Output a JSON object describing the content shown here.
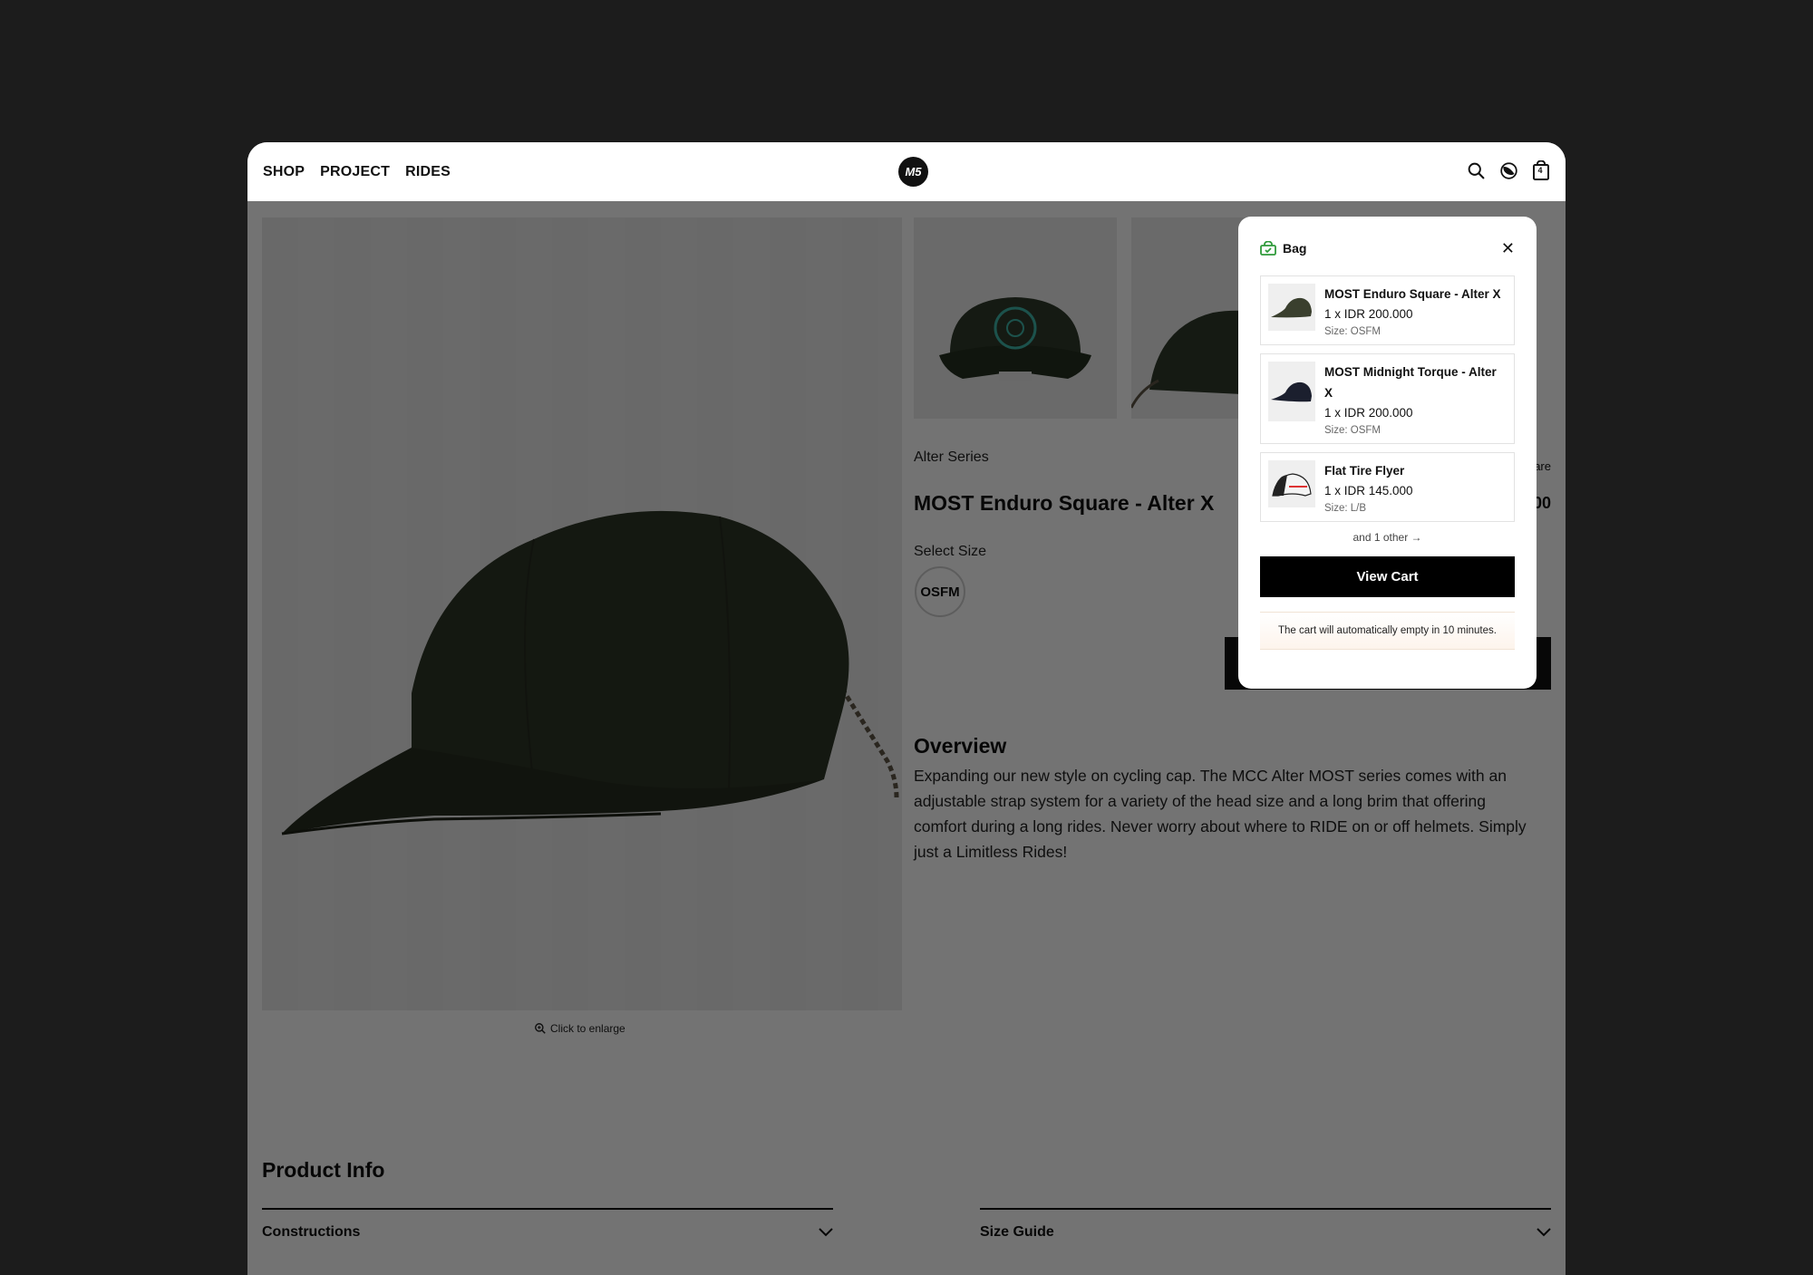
{
  "nav": {
    "items": [
      {
        "label": "SHOP"
      },
      {
        "label": "PROJECT"
      },
      {
        "label": "RIDES"
      }
    ],
    "logo_text": "M5",
    "icons": [
      "search-icon",
      "theme-toggle-icon",
      "cart-icon"
    ],
    "cart_count": "4"
  },
  "product": {
    "series": "Alter Series",
    "title": "MOST Enduro Square - Alter X",
    "price_fragment": "00",
    "share_fragment": "are",
    "select_size_label": "Select Size",
    "size_option": "OSFM",
    "enlarge_label": "Click to enlarge",
    "overview_heading": "Overview",
    "overview_text": "Expanding our new style on cycling cap. The MCC Alter MOST series comes with an adjustable strap system for a variety of the head size and a long brim that offering comfort during a long rides. Never worry about where to RIDE on or off helmets. Simply just a Limitless Rides!",
    "info_heading": "Product Info",
    "accordions": [
      {
        "label": "Constructions"
      },
      {
        "label": "Size Guide"
      }
    ]
  },
  "bag": {
    "title": "Bag",
    "items": [
      {
        "name": "MOST Enduro Square - Alter X",
        "qty_price": "1 x IDR 200.000",
        "size": "Size: OSFM",
        "color": "#3a3f2e"
      },
      {
        "name": "MOST Midnight Torque - Alter X",
        "qty_price": "1 x IDR 200.000",
        "size": "Size: OSFM",
        "color": "#1b1f2e"
      },
      {
        "name": "Flat Tire Flyer",
        "qty_price": "1 x IDR 145.000",
        "size": "Size: L/B",
        "color": "#f4f4f4"
      }
    ],
    "others_label": "and 1 other →",
    "view_cart_label": "View Cart",
    "note": "The cart will automatically empty in 10 minutes."
  },
  "colors": {
    "cap_green": "#3b4530",
    "accent_green": "#2f9a3a",
    "overlay": "rgba(0,0,0,0.55)"
  }
}
